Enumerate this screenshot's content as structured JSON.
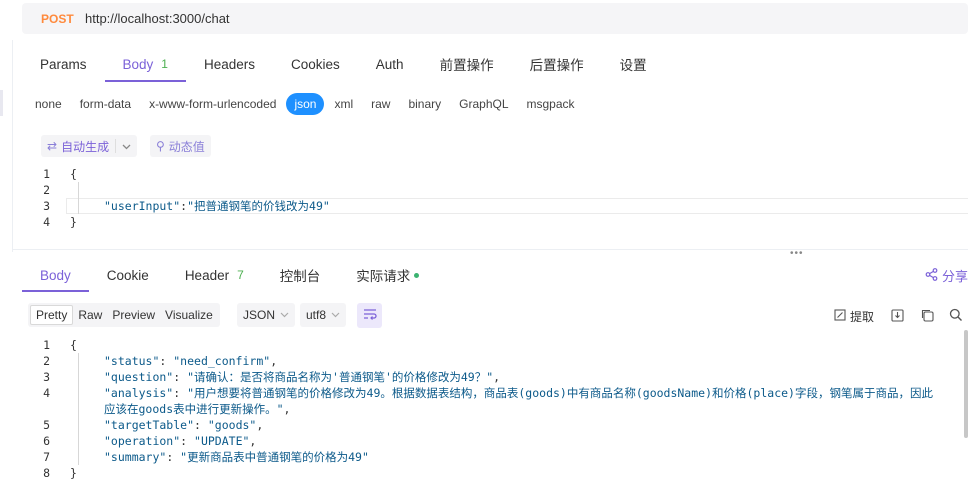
{
  "request": {
    "method": "POST",
    "url": "http://localhost:3000/chat"
  },
  "request_tabs": [
    {
      "label": "Params"
    },
    {
      "label": "Body",
      "count": "1"
    },
    {
      "label": "Headers"
    },
    {
      "label": "Cookies"
    },
    {
      "label": "Auth"
    },
    {
      "label": "前置操作"
    },
    {
      "label": "后置操作"
    },
    {
      "label": "设置"
    }
  ],
  "body_types": [
    "none",
    "form-data",
    "x-www-form-urlencoded",
    "json",
    "xml",
    "raw",
    "binary",
    "GraphQL",
    "msgpack"
  ],
  "body_type_selected": "json",
  "tools": {
    "auto_generate": "自动生成",
    "dynamic_value": "动态值"
  },
  "request_body": {
    "line_numbers": [
      "1",
      "2",
      "3",
      "4"
    ],
    "line1": "{",
    "line3_key": "\"userInput\"",
    "line3_colon": ":",
    "line3_value": "\"把普通钢笔的价钱改为49\"",
    "line4": "}"
  },
  "response_tabs": [
    {
      "label": "Body"
    },
    {
      "label": "Cookie"
    },
    {
      "label": "Header",
      "count": "7"
    },
    {
      "label": "控制台"
    },
    {
      "label": "实际请求"
    }
  ],
  "share_label": "分享",
  "view_modes": [
    "Pretty",
    "Raw",
    "Preview",
    "Visualize"
  ],
  "view_mode_selected": "Pretty",
  "format_select": "JSON",
  "encoding_select": "utf8",
  "extract_label": "提取",
  "response_body": {
    "line_numbers": [
      "1",
      "2",
      "3",
      "4",
      "",
      "5",
      "6",
      "7",
      "8"
    ],
    "open": "{",
    "close": "}",
    "fields": [
      {
        "key": "\"status\"",
        "value": "\"need_confirm\"",
        "tail": ","
      },
      {
        "key": "\"question\"",
        "value": "\"请确认：是否将商品名称为'普通钢笔'的价格修改为49？\"",
        "tail": ","
      },
      {
        "key": "\"analysis\"",
        "value": "\"用户想要将普通钢笔的价格修改为49。根据数据表结构，商品表(goods)中有商品名称(goodsName)和价格(place)字段，钢笔属于商品，因此",
        "tail": ""
      },
      {
        "key": "",
        "value": "应该在goods表中进行更新操作。\"",
        "tail": ","
      },
      {
        "key": "\"targetTable\"",
        "value": "\"goods\"",
        "tail": ","
      },
      {
        "key": "\"operation\"",
        "value": "\"UPDATE\"",
        "tail": ","
      },
      {
        "key": "\"summary\"",
        "value": "\"更新商品表中普通钢笔的价格为49\"",
        "tail": ""
      }
    ]
  },
  "colors": {
    "accent": "#7b61d8",
    "method": "#ff8a3d",
    "json_active": "#1e90ff",
    "code_text": "#0c5a8a",
    "count_green": "#4caf50"
  }
}
